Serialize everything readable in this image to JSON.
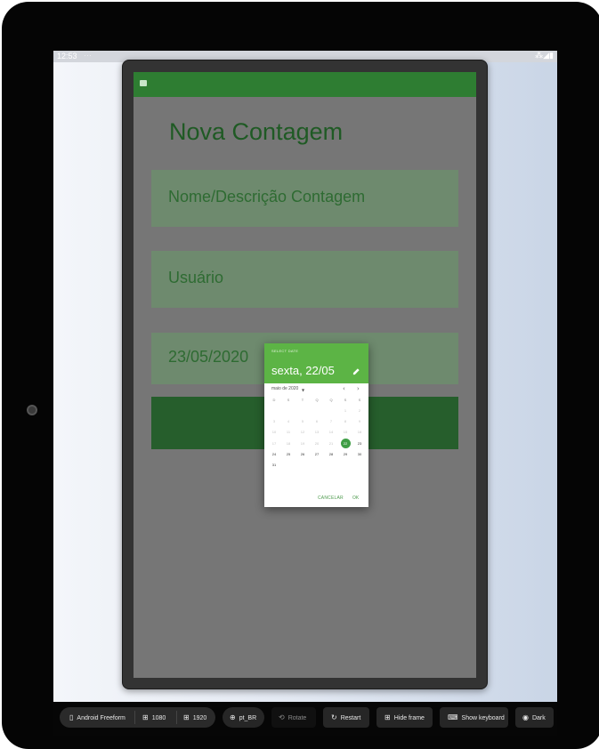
{
  "status_bar": {
    "time": "12:53",
    "dots": "···",
    "icons": "⁂◢▮"
  },
  "app": {
    "title": "Nova Contagem",
    "name_field": "Nome/Descrição Contagem",
    "user_field": "Usuário",
    "date_field": "23/05/2020"
  },
  "date_picker": {
    "overline": "SELECT DATE",
    "selected_date": "sexta, 22/05",
    "month_label": "maio de 2020",
    "weekdays": [
      "D",
      "S",
      "T",
      "Q",
      "Q",
      "S",
      "S"
    ],
    "weeks": [
      [
        "",
        "",
        "",
        "",
        "",
        "1",
        "2"
      ],
      [
        "3",
        "4",
        "5",
        "6",
        "7",
        "8",
        "9"
      ],
      [
        "10",
        "11",
        "12",
        "13",
        "14",
        "15",
        "16"
      ],
      [
        "17",
        "18",
        "19",
        "20",
        "21",
        "22",
        "23"
      ],
      [
        "24",
        "25",
        "26",
        "27",
        "28",
        "29",
        "30"
      ],
      [
        "31",
        "",
        "",
        "",
        "",
        "",
        ""
      ]
    ],
    "selected_day": "22",
    "last_disabled_day": "21",
    "cancel_label": "CANCELAR",
    "ok_label": "OK",
    "accent_color": "#5cb445"
  },
  "toolbar": {
    "device_label": "Android Freeform",
    "width_label": "1080",
    "height_label": "1920",
    "locale_label": "pt_BR",
    "rotate_label": "Rotate",
    "restart_label": "Restart",
    "hide_frame_label": "Hide frame",
    "show_keyboard_label": "Show keyboard",
    "dark_label": "Dark"
  },
  "colors": {
    "app_bar": "#2e7d32",
    "save_button": "#265e2c",
    "field_fill": "#6e8a6e"
  }
}
